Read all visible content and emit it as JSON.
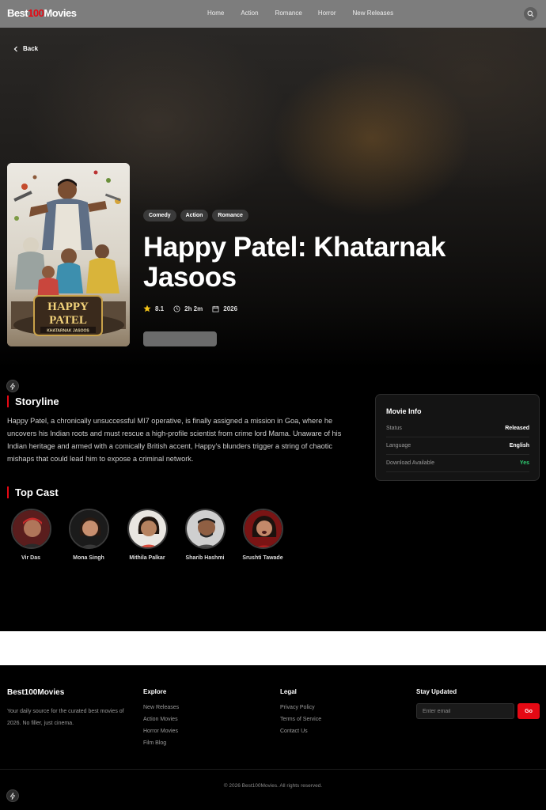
{
  "brand": {
    "name_prefix": "Best",
    "name_accent": "100",
    "name_suffix": "Movies",
    "accent_color": "#e50914"
  },
  "nav": {
    "items": [
      "Home",
      "Action",
      "Romance",
      "Horror",
      "New Releases"
    ]
  },
  "header": {
    "search_icon": "search-icon"
  },
  "hero": {
    "back_label": "Back",
    "genres": [
      "Comedy",
      "Action",
      "Romance"
    ],
    "title": "Happy Patel: Khatarnak Jasoos",
    "rating": "8.1",
    "duration": "2h 2m",
    "year": "2026",
    "poster": {
      "title_line1": "HAPPY",
      "title_line2": "PATEL",
      "subtitle": "KHATARNAK JASOOS"
    }
  },
  "storyline": {
    "heading": "Storyline",
    "text": "Happy Patel, a chronically unsuccessful MI7 operative, is finally assigned a mission in Goa, where he uncovers his Indian roots and must rescue a high-profile scientist from crime lord Mama. Unaware of his Indian heritage and armed with a comically British accent, Happy’s blunders trigger a string of chaotic mishaps that could lead him to expose a criminal network."
  },
  "movie_info": {
    "heading": "Movie Info",
    "rows": [
      {
        "label": "Status",
        "value": "Released"
      },
      {
        "label": "Language",
        "value": "English"
      },
      {
        "label": "Download Available",
        "value": "Yes",
        "value_color": "#2ecc71"
      }
    ]
  },
  "cast": {
    "heading": "Top Cast",
    "members": [
      "Vir Das",
      "Mona Singh",
      "Mithila Palkar",
      "Sharib Hashmi",
      "Srushti Tawade"
    ]
  },
  "footer": {
    "brand": "Best100Movies",
    "tagline": "Your daily source for the curated best movies of 2026. No filler, just cinema.",
    "explore": {
      "title": "Explore",
      "links": [
        "New Releases",
        "Action Movies",
        "Horror Movies",
        "Film Blog"
      ]
    },
    "legal": {
      "title": "Legal",
      "links": [
        "Privacy Policy",
        "Terms of Service",
        "Contact Us"
      ]
    },
    "newsletter": {
      "title": "Stay Updated",
      "placeholder": "Enter email",
      "button": "Go"
    },
    "copyright": "© 2026 Best100Movies. All rights reserved."
  }
}
